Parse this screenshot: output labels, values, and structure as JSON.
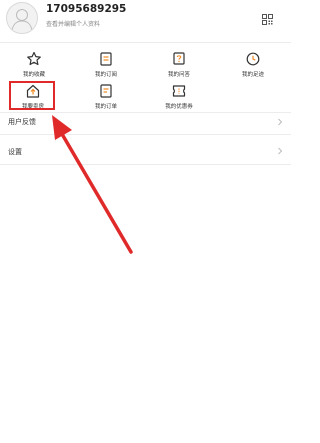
{
  "profile": {
    "username": "17095689295",
    "subtitle": "查看并编辑个人资料"
  },
  "grid": {
    "items": [
      {
        "label": "我的收藏",
        "icon": "star-icon"
      },
      {
        "label": "我的订阅",
        "icon": "subscription-icon"
      },
      {
        "label": "我的问答",
        "icon": "question-icon"
      },
      {
        "label": "我的足迹",
        "icon": "clock-icon"
      },
      {
        "label": "我要卖房",
        "icon": "house-icon"
      },
      {
        "label": "我的订单",
        "icon": "order-icon"
      },
      {
        "label": "我的优惠券",
        "icon": "coupon-icon"
      }
    ]
  },
  "menu": {
    "feedback": "用户反馈",
    "settings": "设置"
  },
  "colors": {
    "accent": "#f08a24",
    "annotation": "#e02a2a"
  }
}
